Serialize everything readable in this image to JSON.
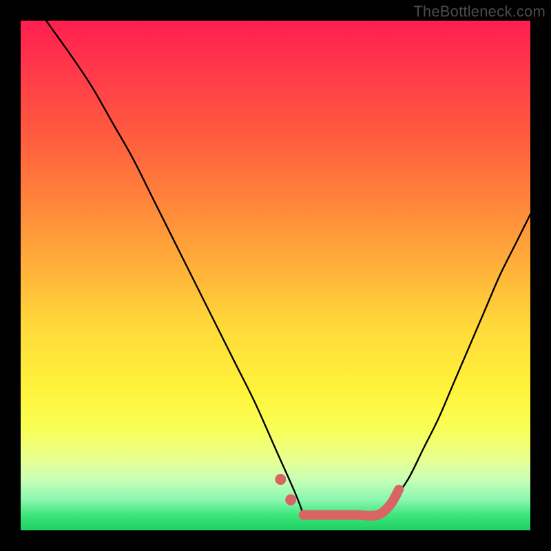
{
  "watermark": "TheBottleneck.com",
  "colors": {
    "frame": "#000000",
    "highlight": "#d96464",
    "curve": "#000000",
    "gradient_top": "#ff1e50",
    "gradient_bottom": "#1fcf65"
  },
  "chart_data": {
    "type": "line",
    "title": "",
    "xlabel": "",
    "ylabel": "",
    "xlim": [
      0,
      100
    ],
    "ylim": [
      0,
      100
    ],
    "note": "Axes unlabeled; y encodes bottleneck percentage (high=red, low=green). Values estimated from pixel positions.",
    "curve_left": {
      "x": [
        5,
        10,
        14,
        18,
        22,
        26,
        30,
        34,
        38,
        42,
        46,
        50,
        54,
        55.5
      ],
      "y": [
        100,
        93,
        87,
        80,
        73,
        65,
        57,
        49,
        41,
        33,
        25,
        16,
        7,
        3
      ]
    },
    "curve_right": {
      "x": [
        70,
        73,
        76,
        79,
        82,
        85,
        88,
        91,
        94,
        97,
        100
      ],
      "y": [
        3,
        6,
        10,
        16,
        22,
        29,
        36,
        43,
        50,
        56,
        62
      ]
    },
    "flat_bottom": {
      "x": [
        55.5,
        70
      ],
      "y": [
        3,
        3
      ]
    },
    "highlight_dots": [
      {
        "x": 51,
        "y": 10
      },
      {
        "x": 53,
        "y": 6
      }
    ],
    "highlight_segment": {
      "x": [
        55.5,
        58,
        62,
        66,
        70,
        72.5,
        74.2
      ],
      "y": [
        3,
        3,
        3,
        3,
        3,
        5,
        8
      ]
    }
  }
}
